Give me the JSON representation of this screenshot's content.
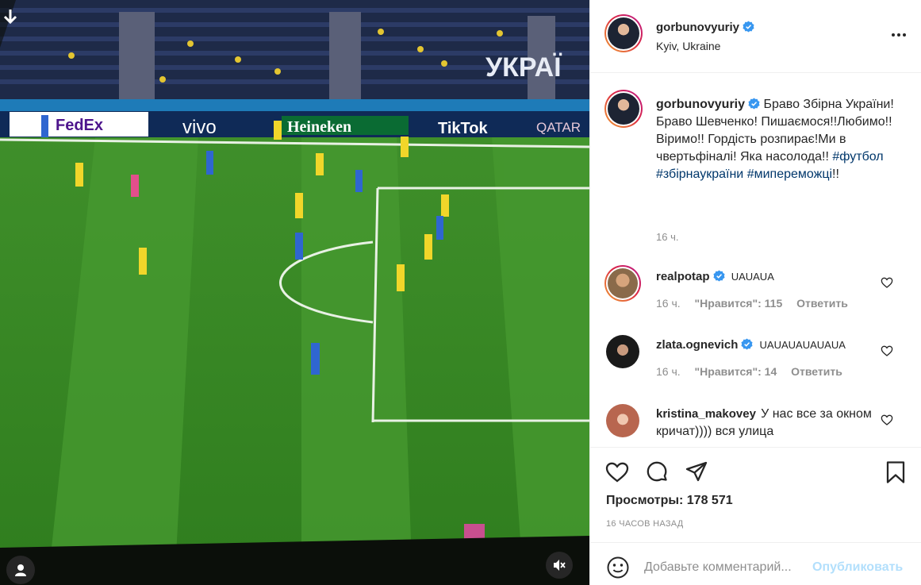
{
  "post": {
    "author": "gorbunovyuriy",
    "location": "Kyiv, Ukraine",
    "caption_author": "gorbunovyuriy",
    "caption_text": "Браво Збірна України!Браво Шевченко! Пишаємося!!Любимо!!Віримо!! Гордість розпирає!Ми в чвертьфіналі! Яка насолода!!",
    "hashtags": [
      "#футбол",
      "#збірнаукраїни",
      "#миперeможці"
    ],
    "hashtag_suffix": "!!",
    "caption_time": "16 ч.",
    "views_label": "Просмотры: 178 571",
    "posted_ago": "16 ЧАСОВ НАЗАД"
  },
  "media": {
    "ads": [
      "FedEx",
      "vivo",
      "Heineken",
      "TikTok",
      "QATAR"
    ],
    "stand_text": "УКРАЇ"
  },
  "comments": [
    {
      "user": "realpotap",
      "verified": true,
      "text": "UAUAUA",
      "time": "16 ч.",
      "likes": "\"Нравится\": 115",
      "reply": "Ответить"
    },
    {
      "user": "zlata.ognevich",
      "verified": true,
      "text": "UAUAUAUAUAUA",
      "time": "16 ч.",
      "likes": "\"Нравится\": 14",
      "reply": "Ответить"
    },
    {
      "user": "kristina_makovey",
      "verified": false,
      "text": "У нас все за окном кричат)))) вся улица",
      "time": "",
      "likes": "",
      "reply": ""
    }
  ],
  "add_comment": {
    "placeholder": "Добавьте комментарий...",
    "publish_label": "Опубликовать"
  },
  "icons": {
    "verified": "verified-badge-icon",
    "more": "more-options-icon",
    "like": "heart-icon",
    "comment": "comment-icon",
    "share": "share-icon",
    "save": "bookmark-icon",
    "emoji": "emoji-icon",
    "mute": "muted-speaker-icon",
    "tags": "user-tag-icon"
  },
  "colors": {
    "verified": "#3897f0",
    "link": "#00376b",
    "muted_text": "#8e8e8e",
    "publish_disabled": "#b2dffc"
  }
}
